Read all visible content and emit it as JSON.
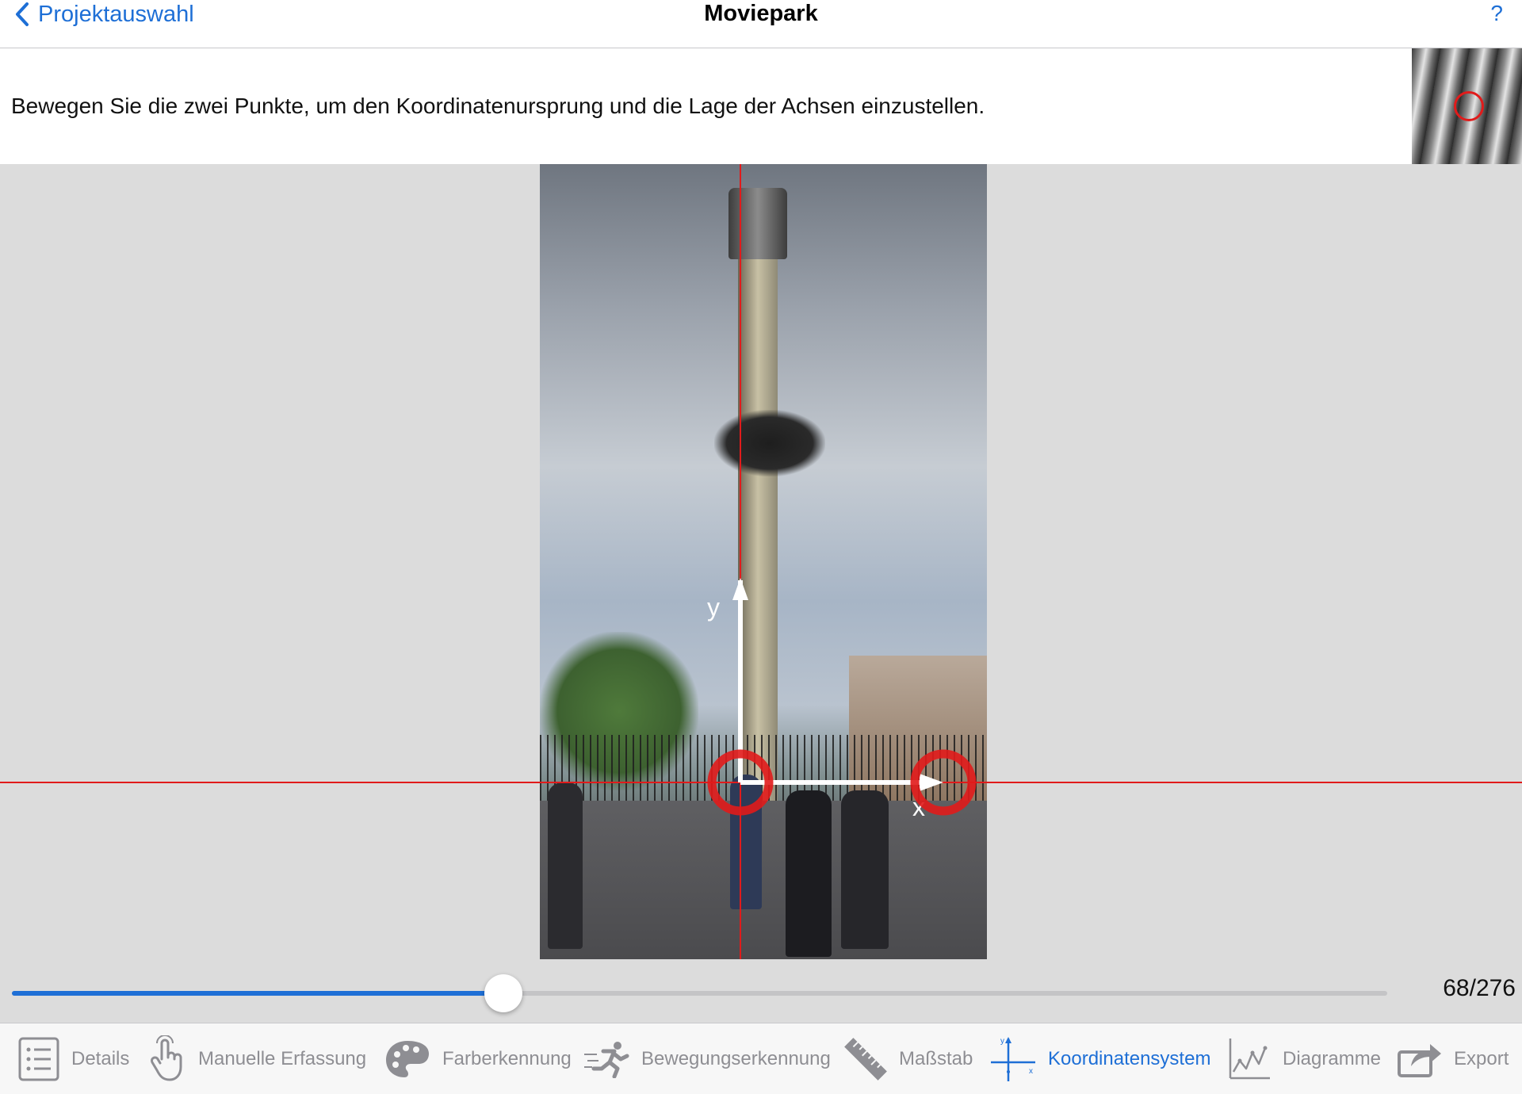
{
  "nav": {
    "back_label": "Projektauswahl",
    "title": "Moviepark",
    "help_label": "?"
  },
  "instruction": {
    "text": "Bewegen Sie die zwei Punkte, um den Koordinatenursprung und die Lage der Achsen einzustellen."
  },
  "axes": {
    "y_label": "y",
    "x_label": "x"
  },
  "slider": {
    "current_frame": 68,
    "total_frames": 276,
    "counter_text": "68/276"
  },
  "tabs": [
    {
      "label": "Details",
      "icon": "list-icon",
      "active": false
    },
    {
      "label": "Manuelle Erfassung",
      "icon": "hand-pointer-icon",
      "active": false
    },
    {
      "label": "Farberkennung",
      "icon": "palette-icon",
      "active": false
    },
    {
      "label": "Bewegungserkennung",
      "icon": "running-person-icon",
      "active": false
    },
    {
      "label": "Maßstab",
      "icon": "ruler-icon",
      "active": false
    },
    {
      "label": "Koordinatensystem",
      "icon": "coordinate-axes-icon",
      "active": true
    },
    {
      "label": "Diagramme",
      "icon": "line-chart-icon",
      "active": false
    },
    {
      "label": "Export",
      "icon": "share-icon",
      "active": false
    }
  ],
  "colors": {
    "accent": "#1e6fd6",
    "axis_line": "#e11b1b",
    "tab_inactive": "#8e8e93"
  }
}
